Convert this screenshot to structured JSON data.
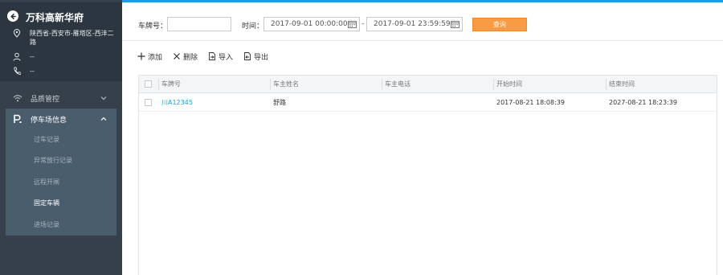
{
  "sidebar": {
    "estate_name": "万科高新华府",
    "address": "陕西省-西安市-雁塔区-西沣二路",
    "person": "--",
    "phone": "--",
    "nav": {
      "quality": "品质管控",
      "parking": "停车场信息",
      "parking_items": [
        "过车记录",
        "异常放行记录",
        "远程开闸",
        "固定车辆",
        "进场记录"
      ],
      "active_item": "固定车辆"
    }
  },
  "filters": {
    "plate_label": "车牌号：",
    "plate_value": "",
    "time_label": "时间：",
    "start_time": "2017-09-01 00:00:00",
    "separator": "-",
    "end_time": "2017-09-01 23:59:59",
    "query_label": "查询"
  },
  "toolbar": {
    "add": "添加",
    "delete": "删除",
    "import": "导入",
    "export": "导出"
  },
  "table": {
    "headers": [
      "车牌号",
      "车主姓名",
      "车主电话",
      "开始时间",
      "结束时间"
    ],
    "rows": [
      {
        "plate": "川A12345",
        "owner": "舒路",
        "phone": "",
        "start": "2017-08-21 18:08:39",
        "end": "2027-08-21 18:23:39"
      }
    ]
  },
  "colors": {
    "accent": "#1e9ee0",
    "query_button": "#f99b44",
    "sidebar_bg": "#36404a",
    "sidebar_head_bg": "#2c3640",
    "submenu_bg": "#4a5d6d"
  },
  "icons": {
    "back": "back-arrow-icon",
    "address": "location-pin-icon",
    "person": "user-icon",
    "phone": "phone-icon",
    "quality": "wifi-icon",
    "parking": "parking-icon",
    "calendar": "calendar-icon"
  }
}
